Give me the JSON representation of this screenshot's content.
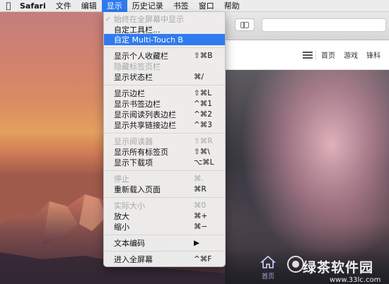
{
  "menubar": {
    "apple_icon": "apple-icon",
    "items": [
      "Safari",
      "文件",
      "编辑",
      "显示",
      "历史记录",
      "书签",
      "窗口",
      "帮助"
    ],
    "active_index": 3
  },
  "dropdown": {
    "items": [
      {
        "label": "始终在全屏幕中显示工具栏",
        "shortcut": "",
        "checked": true,
        "disabled": true
      },
      {
        "label": "自定工具栏...",
        "shortcut": ""
      },
      {
        "label": "自定 Multi-Touch Bar...",
        "shortcut": "",
        "highlighted": true
      },
      {
        "label": "显示个人收藏栏",
        "shortcut": "⇧⌘B"
      },
      {
        "label": "隐藏标签页栏",
        "shortcut": "",
        "disabled": true
      },
      {
        "label": "显示状态栏",
        "shortcut": "⌘/"
      },
      {
        "label": "显示边栏",
        "shortcut": "⇧⌘L"
      },
      {
        "label": "显示书签边栏",
        "shortcut": "^⌘1"
      },
      {
        "label": "显示阅读列表边栏",
        "shortcut": "^⌘2"
      },
      {
        "label": "显示共享链接边栏",
        "shortcut": "^⌘3"
      },
      {
        "label": "显示阅读器",
        "shortcut": "⇧⌘R",
        "disabled": true
      },
      {
        "label": "显示所有标签页",
        "shortcut": "⇧⌘\\"
      },
      {
        "label": "显示下载项",
        "shortcut": "⌥⌘L"
      },
      {
        "label": "停止",
        "shortcut": "⌘.",
        "disabled": true
      },
      {
        "label": "重新载入页面",
        "shortcut": "⌘R"
      },
      {
        "label": "实际大小",
        "shortcut": "⌘0",
        "disabled": true
      },
      {
        "label": "放大",
        "shortcut": "⌘+"
      },
      {
        "label": "缩小",
        "shortcut": "⌘−"
      },
      {
        "label": "文本编码",
        "shortcut": "▶"
      },
      {
        "label": "进入全屏幕",
        "shortcut": "^⌘F"
      }
    ]
  },
  "safari": {
    "nav_links": [
      "首页",
      "游戏",
      "锋科"
    ],
    "home_label": "首页"
  },
  "watermark": {
    "text": "绿茶软件园",
    "url": "www.33lc.com"
  },
  "colors": {
    "menu_highlight": "#2f7bef",
    "desktop_sunset": "#d98a64"
  }
}
